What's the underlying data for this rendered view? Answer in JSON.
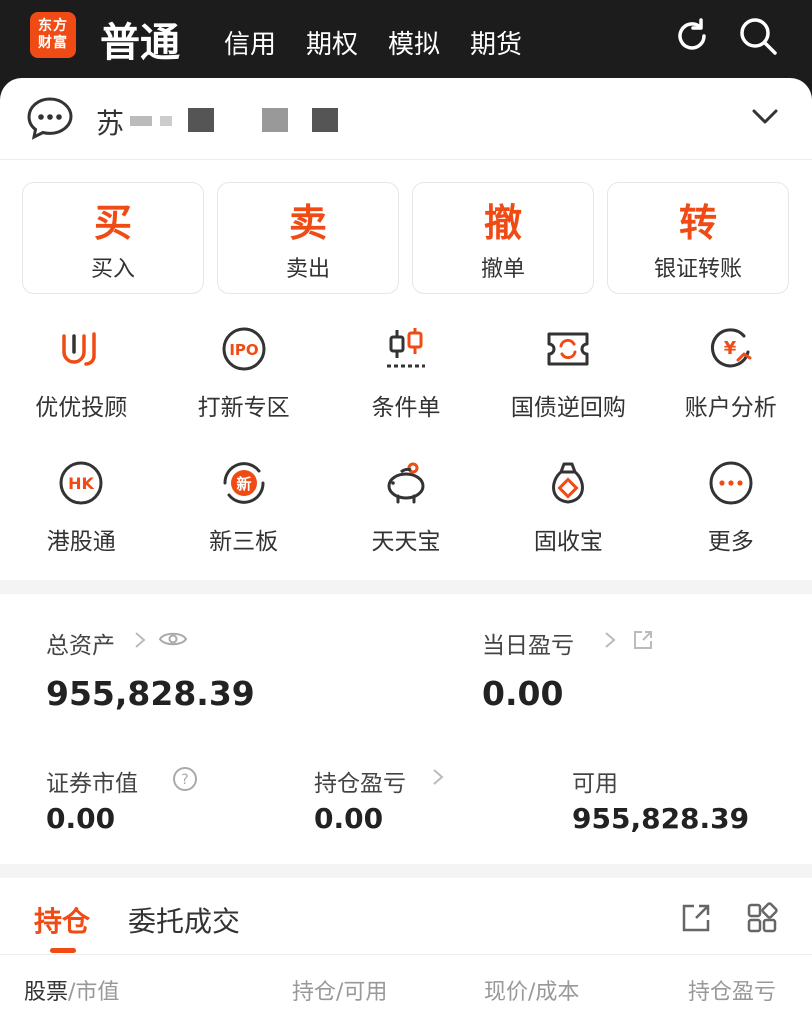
{
  "header": {
    "logo_line1": "东方",
    "logo_line2": "财富",
    "active_tab": "普通",
    "tabs": [
      "信用",
      "期权",
      "模拟",
      "期货"
    ]
  },
  "account": {
    "name_prefix": "苏"
  },
  "actions": [
    {
      "big": "买",
      "sub": "买入"
    },
    {
      "big": "卖",
      "sub": "卖出"
    },
    {
      "big": "撤",
      "sub": "撤单"
    },
    {
      "big": "转",
      "sub": "银证转账"
    }
  ],
  "grid": [
    [
      {
        "label": "优优投顾",
        "icon": "youyou-icon"
      },
      {
        "label": "打新专区",
        "icon": "ipo-icon"
      },
      {
        "label": "条件单",
        "icon": "candlestick-icon"
      },
      {
        "label": "国债逆回购",
        "icon": "repo-icon"
      },
      {
        "label": "账户分析",
        "icon": "yen-chart-icon"
      }
    ],
    [
      {
        "label": "港股通",
        "icon": "hk-icon"
      },
      {
        "label": "新三板",
        "icon": "new-board-icon"
      },
      {
        "label": "天天宝",
        "icon": "piggy-bank-icon"
      },
      {
        "label": "固收宝",
        "icon": "money-bag-icon"
      },
      {
        "label": "更多",
        "icon": "more-icon"
      }
    ]
  ],
  "assets": {
    "total_label": "总资产",
    "total_value": "955,828.39",
    "daily_pl_label": "当日盈亏",
    "daily_pl_value": "0.00",
    "securities_label": "证券市值",
    "securities_value": "0.00",
    "position_pl_label": "持仓盈亏",
    "position_pl_value": "0.00",
    "available_label": "可用",
    "available_value": "955,828.39"
  },
  "holdings": {
    "tab_active": "持仓",
    "tab_other": "委托成交",
    "columns": [
      {
        "main": "股票",
        "sub": "/市值"
      },
      {
        "main": "持仓",
        "sub": "/可用"
      },
      {
        "main": "现价",
        "sub": "/成本"
      },
      {
        "main": "持仓盈亏",
        "sub": ""
      }
    ]
  },
  "colors": {
    "accent": "#f04b14",
    "header_bg": "#1c1c1c"
  }
}
